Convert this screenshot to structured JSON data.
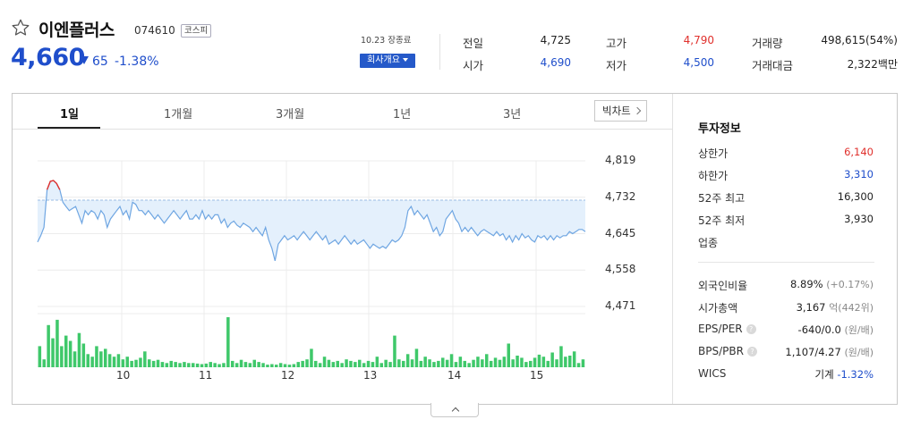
{
  "header": {
    "name": "이엔플러스",
    "code": "074610",
    "market": "코스피",
    "price": "4,660",
    "change": "65",
    "change_pct": "-1.38%",
    "date_note": "10.23 장종료",
    "company_button": "회사개요"
  },
  "quote": {
    "prev_close_label": "전일",
    "prev_close": "4,725",
    "open_label": "시가",
    "open": "4,690",
    "high_label": "고가",
    "high": "4,790",
    "low_label": "저가",
    "low": "4,500",
    "volume_label": "거래량",
    "volume": "498,615(54%)",
    "value_label": "거래대금",
    "value": "2,322백만"
  },
  "tabs": [
    "1일",
    "1개월",
    "3개월",
    "1년",
    "3년"
  ],
  "big_chart_label": "빅차트",
  "colors": {
    "up": "#e0302c",
    "down": "#1f4ecb",
    "area": "#e4f0fc",
    "line": "#6fa6e2",
    "volume": "#3fc86a"
  },
  "chart_data": {
    "type": "line",
    "ylim": [
      4471,
      4819
    ],
    "yticks": [
      "4,819",
      "4,732",
      "4,645",
      "4,558",
      "4,471"
    ],
    "xticks": [
      "10",
      "11",
      "12",
      "13",
      "14",
      "15"
    ],
    "reference_line": 4725,
    "price": [
      4625,
      4640,
      4660,
      4750,
      4770,
      4772,
      4765,
      4750,
      4720,
      4710,
      4700,
      4705,
      4710,
      4690,
      4670,
      4700,
      4690,
      4700,
      4695,
      4680,
      4700,
      4690,
      4660,
      4680,
      4690,
      4700,
      4710,
      4690,
      4700,
      4680,
      4720,
      4715,
      4700,
      4700,
      4690,
      4700,
      4690,
      4680,
      4690,
      4680,
      4670,
      4680,
      4690,
      4700,
      4690,
      4680,
      4690,
      4700,
      4680,
      4680,
      4690,
      4680,
      4700,
      4680,
      4690,
      4680,
      4690,
      4690,
      4670,
      4680,
      4660,
      4670,
      4675,
      4665,
      4660,
      4670,
      4665,
      4660,
      4650,
      4660,
      4650,
      4640,
      4660,
      4630,
      4610,
      4580,
      4620,
      4630,
      4640,
      4630,
      4635,
      4640,
      4630,
      4640,
      4650,
      4640,
      4630,
      4640,
      4650,
      4640,
      4630,
      4640,
      4620,
      4625,
      4630,
      4620,
      4630,
      4640,
      4630,
      4620,
      4630,
      4620,
      4625,
      4630,
      4620,
      4610,
      4620,
      4615,
      4610,
      4615,
      4610,
      4620,
      4630,
      4625,
      4630,
      4640,
      4660,
      4700,
      4710,
      4690,
      4700,
      4690,
      4680,
      4690,
      4670,
      4650,
      4660,
      4640,
      4650,
      4680,
      4690,
      4700,
      4680,
      4670,
      4650,
      4660,
      4650,
      4660,
      4650,
      4640,
      4650,
      4655,
      4650,
      4645,
      4640,
      4650,
      4640,
      4645,
      4630,
      4640,
      4625,
      4640,
      4630,
      4645,
      4635,
      4640,
      4630,
      4625,
      4640,
      4635,
      4640,
      4630,
      4640,
      4630,
      4640,
      4635,
      4640,
      4640,
      4650,
      4645,
      4650,
      4655,
      4655,
      4650
    ],
    "volume": [
      40,
      15,
      80,
      55,
      90,
      40,
      60,
      50,
      30,
      65,
      45,
      25,
      20,
      40,
      30,
      35,
      25,
      20,
      25,
      15,
      20,
      12,
      14,
      18,
      30,
      15,
      12,
      14,
      10,
      8,
      12,
      10,
      8,
      10,
      8,
      8,
      7,
      6,
      7,
      10,
      8,
      6,
      8,
      95,
      12,
      8,
      14,
      10,
      8,
      14,
      10,
      8,
      5,
      6,
      5,
      8,
      6,
      5,
      6,
      10,
      12,
      15,
      35,
      12,
      8,
      20,
      14,
      10,
      12,
      8,
      15,
      12,
      10,
      14,
      8,
      12,
      10,
      20,
      8,
      14,
      10,
      60,
      15,
      12,
      25,
      15,
      35,
      12,
      20,
      15,
      10,
      12,
      18,
      14,
      25,
      10,
      20,
      12,
      8,
      14,
      20,
      15,
      25,
      12,
      18,
      14,
      20,
      45,
      15,
      22,
      18,
      10,
      12,
      18,
      24,
      20,
      12,
      28,
      15,
      40,
      20,
      22,
      30,
      8,
      15
    ]
  },
  "invest": {
    "title": "투자정보",
    "upper_limit_label": "상한가",
    "upper_limit": "6,140",
    "lower_limit_label": "하한가",
    "lower_limit": "3,310",
    "high52_label": "52주 최고",
    "high52": "16,300",
    "low52_label": "52주 최저",
    "low52": "3,930",
    "sector_label": "업종",
    "foreign_label": "외국인비율",
    "foreign": "8.89%",
    "foreign_chg": "(+0.17%)",
    "mcap_label": "시가총액",
    "mcap": "3,167",
    "mcap_unit": "억(442위)",
    "eps_label": "EPS/PER",
    "eps": "-640/0.0",
    "eps_unit": "(원/배)",
    "bps_label": "BPS/PBR",
    "bps": "1,107/4.27",
    "bps_unit": "(원/배)",
    "wics_label": "WICS",
    "wics": "기계",
    "wics_chg": "-1.32%"
  }
}
